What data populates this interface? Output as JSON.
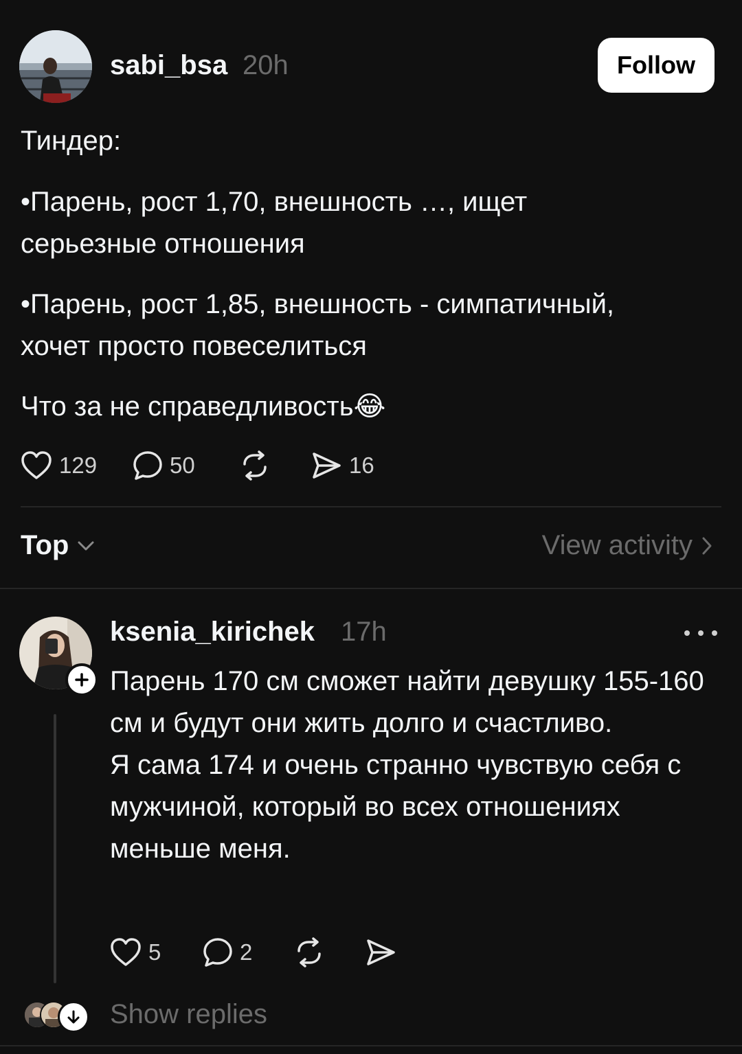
{
  "post": {
    "author": "sabi_bsa",
    "time": "20h",
    "follow_label": "Follow",
    "paragraphs": [
      "Тиндер:",
      "•Парень, рост 1,70, внешность …, ищет серьезные отношения",
      "•Парень, рост 1,85, внешность - симпатичный, хочет просто повеселиться",
      "Что за не справедливость😂"
    ],
    "actions": {
      "likes": "129",
      "comments": "50",
      "shares": "16"
    }
  },
  "sort_bar": {
    "label": "Top",
    "view_activity": "View activity"
  },
  "reply": {
    "author": "ksenia_kirichek",
    "time": "17h",
    "text_lines": [
      "Парень 170 см сможет найти девушку 155-160 см и будут они жить долго и счастливо.",
      "Я сама 174 и очень странно чувствую себя с мужчиной, который во всех отношениях меньше меня."
    ],
    "actions": {
      "likes": "5",
      "comments": "2"
    },
    "show_replies": "Show replies"
  },
  "icons": {
    "like": "heart-icon",
    "comment": "comment-bubble-icon",
    "repost": "repost-icon",
    "share": "send-icon",
    "chevron_down": "chevron-down-icon",
    "chevron_right": "chevron-right-icon",
    "more": "more-dots-icon",
    "follow_plus": "plus-icon",
    "expand": "arrow-down-icon"
  },
  "colors": {
    "background": "#101010",
    "text_primary": "#f3f5f7",
    "text_secondary": "#6b6b6b",
    "divider": "#262626",
    "follow_button_bg": "#ffffff"
  }
}
